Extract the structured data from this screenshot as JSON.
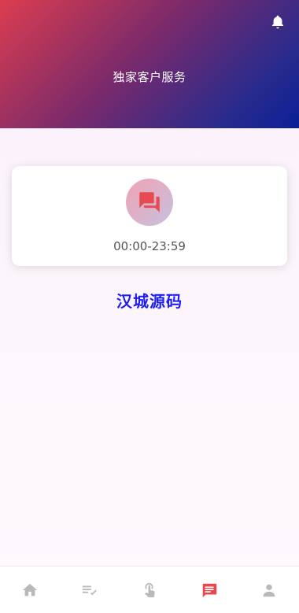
{
  "header": {
    "title": "独家客户服务",
    "notification_icon": "bell-icon"
  },
  "support_card": {
    "icon": "chat-bubbles-icon",
    "hours": "00:00-23:59"
  },
  "brand": {
    "text": "汉城源码",
    "color": "#1f1ff0"
  },
  "bottom_nav": {
    "items": [
      {
        "icon": "home-icon",
        "active": false
      },
      {
        "icon": "list-check-icon",
        "active": false
      },
      {
        "icon": "touch-gesture-icon",
        "active": false
      },
      {
        "icon": "message-icon",
        "active": true
      },
      {
        "icon": "person-icon",
        "active": false
      }
    ],
    "active_color": "#e8474f",
    "inactive_color": "#b9b9b9"
  }
}
